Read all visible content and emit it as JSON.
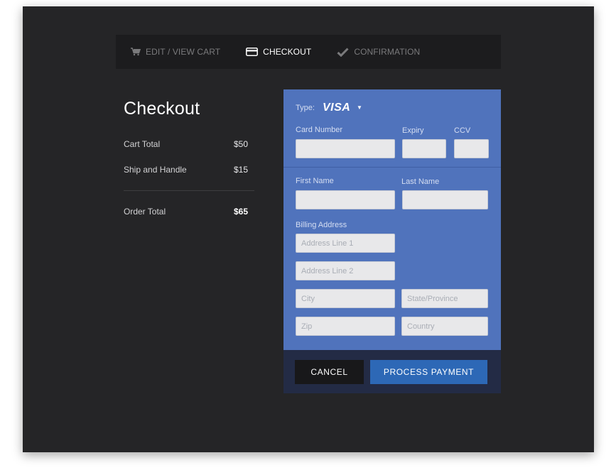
{
  "steps": [
    {
      "label": "EDIT / VIEW CART",
      "icon": "cart-icon"
    },
    {
      "label": "CHECKOUT",
      "icon": "credit-card-icon"
    },
    {
      "label": "CONFIRMATION",
      "icon": "checkmark-icon"
    }
  ],
  "summary": {
    "title": "Checkout",
    "cart_total_label": "Cart Total",
    "cart_total_value": "$50",
    "ship_label": "Ship and Handle",
    "ship_value": "$15",
    "order_total_label": "Order Total",
    "order_total_value": "$65"
  },
  "payment": {
    "type_label": "Type:",
    "card_type": "VISA",
    "card_number_label": "Card Number",
    "expiry_label": "Expiry",
    "ccv_label": "CCV",
    "first_name_label": "First Name",
    "last_name_label": "Last Name",
    "billing_label": "Billing Address",
    "address1_placeholder": "Address Line 1",
    "address2_placeholder": "Address Line 2",
    "city_placeholder": "City",
    "state_placeholder": "State/Province",
    "zip_placeholder": "Zip",
    "country_placeholder": "Country"
  },
  "actions": {
    "cancel_label": "CANCEL",
    "pay_label": "PROCESS PAYMENT"
  },
  "colors": {
    "panel": "#5073bc",
    "pay_button": "#2d68b6",
    "background": "#252527"
  }
}
